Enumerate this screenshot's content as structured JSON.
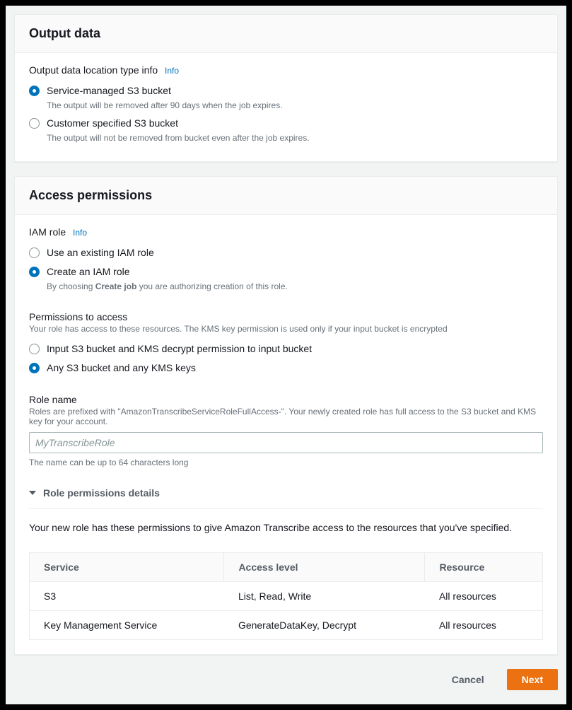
{
  "outputData": {
    "title": "Output data",
    "locationLabel": "Output data location type info",
    "infoLink": "Info",
    "options": [
      {
        "label": "Service-managed S3 bucket",
        "desc": "The output will be removed after 90 days when the job expires.",
        "selected": true
      },
      {
        "label": "Customer specified S3 bucket",
        "desc": "The output will not be removed from bucket even after the job expires.",
        "selected": false
      }
    ]
  },
  "accessPermissions": {
    "title": "Access permissions",
    "iamRoleLabel": "IAM role",
    "infoLink": "Info",
    "iamOptions": [
      {
        "label": "Use an existing IAM role",
        "selected": false
      },
      {
        "label": "Create an IAM role",
        "desc_prefix": "By choosing ",
        "desc_bold": "Create job",
        "desc_suffix": " you are authorizing creation of this role.",
        "selected": true
      }
    ],
    "permsLabel": "Permissions to access",
    "permsDesc": "Your role has access to these resources. The KMS key permission is used only if your input bucket is encrypted",
    "permsOptions": [
      {
        "label": "Input S3 bucket and KMS decrypt permission to input bucket",
        "selected": false
      },
      {
        "label": "Any S3 bucket and any KMS keys",
        "selected": true
      }
    ],
    "roleNameLabel": "Role name",
    "roleNameDesc": "Roles are prefixed with \"AmazonTranscribeServiceRoleFullAccess-\". Your newly created role has full access to the S3 bucket and KMS key for your account.",
    "roleNamePlaceholder": "MyTranscribeRole",
    "roleNameHint": "The name can be up to 64 characters long",
    "detailsTitle": "Role permissions details",
    "detailsDesc": "Your new role has these permissions to give Amazon Transcribe access to the resources that you've specified.",
    "table": {
      "headers": [
        "Service",
        "Access level",
        "Resource"
      ],
      "rows": [
        [
          "S3",
          "List, Read, Write",
          "All resources"
        ],
        [
          "Key Management Service",
          "GenerateDataKey, Decrypt",
          "All resources"
        ]
      ]
    }
  },
  "footer": {
    "cancel": "Cancel",
    "next": "Next"
  }
}
